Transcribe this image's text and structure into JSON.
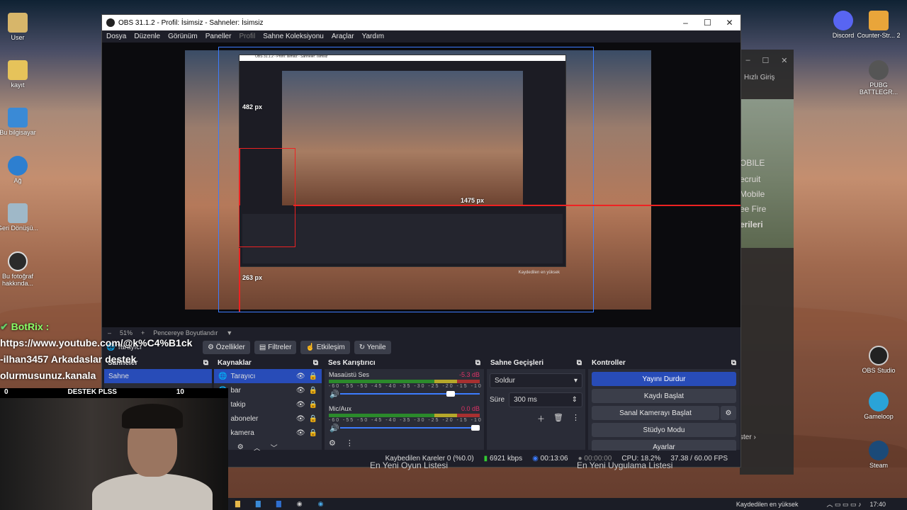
{
  "window": {
    "title": "OBS 31.1.2 - Profil: İsimsiz - Sahneler: İsimsiz",
    "controls": {
      "minimize": "–",
      "maximize": "☐",
      "close": "✕"
    }
  },
  "menu": [
    "Dosya",
    "Düzenle",
    "Görünüm",
    "Paneller",
    "Profil",
    "Sahne Koleksiyonu",
    "Araçlar",
    "Yardım"
  ],
  "preview": {
    "measurements": {
      "top": "482 px",
      "right": "1475 px",
      "bottom": "263 px"
    },
    "nested_title": "OBS 31.1.2 - Profil: İsimsiz - Sahneler: İsimsiz",
    "nested_status": "Kaydedilen en yüksek"
  },
  "zoom": {
    "minus": "–",
    "level": "51%",
    "plus": "+",
    "mode": "Pencereye Boyutlandır",
    "caret": "▼"
  },
  "context_bar": {
    "source_name": "Tarayıcı",
    "buttons": [
      "Özellikler",
      "Filtreler",
      "Etkileşim",
      "Yenile"
    ]
  },
  "docks": {
    "scenes": {
      "title": "Sahneler",
      "items": [
        "Sahne"
      ]
    },
    "sources": {
      "title": "Kaynaklar",
      "items": [
        {
          "name": "Tarayıcı",
          "selected": true
        },
        {
          "name": "bar",
          "selected": false
        },
        {
          "name": "takip",
          "selected": false
        },
        {
          "name": "aboneler",
          "selected": false
        },
        {
          "name": "kamera",
          "selected": false
        }
      ]
    },
    "mixer": {
      "title": "Ses Karıştırıcı",
      "channels": [
        {
          "name": "Masaüstü Ses",
          "db": "-5.3 dB",
          "volume": 0.82
        },
        {
          "name": "Mic/Aux",
          "db": "0.0 dB",
          "volume": 1.0
        }
      ],
      "ticks": "-60 -55 -50 -45 -40 -35 -30 -25 -20 -15 -10 -5 0"
    },
    "transitions": {
      "title": "Sahne Geçişleri",
      "type": "Soldur",
      "duration_label": "Süre",
      "duration": "300 ms"
    },
    "controls": {
      "title": "Kontroller",
      "buttons": [
        "Yayını Durdur",
        "Kaydı Başlat",
        "Sanal Kamerayı Başlat",
        "Stüdyo Modu",
        "Ayarlar"
      ]
    }
  },
  "status": {
    "dropped": "Kaybedilen Kareler 0 (%0.0)",
    "bitrate": "6921 kbps",
    "stream_time": "00:13:06",
    "rec_time": "00:00:00",
    "cpu": "CPU: 18.2%",
    "fps": "37.38 / 60.00 FPS"
  },
  "overlay": {
    "chat_user": "BotRix :",
    "chat_lines": [
      "https://www.youtube.com/@k%C4%B1ck",
      "-ilhan3457 Arkadaslar destek",
      "olurmusunuz.kanala"
    ],
    "goal_left": "0",
    "goal_label": "DESTEK PLSS",
    "goal_right": "10"
  },
  "behind_window": {
    "quick_login": "Hızlı Giriş",
    "items": [
      "OBILE",
      "ecruit",
      "Mobile",
      "ee Fire",
      "erileri"
    ],
    "more": "ster ›"
  },
  "background_text": {
    "games": "En Yeni Oyun Listesi",
    "apps": "En Yeni Uygulama Listesi"
  },
  "desktop_icons_left": [
    "User",
    "kayıt",
    "Bu bilgisayar",
    "Ağ",
    "Geri Dönüşü...",
    "Bu fotoğraf hakkında..."
  ],
  "desktop_icons_right": [
    "Discord",
    "Counter-Str... 2",
    "PUBG BATTLEGR...",
    "OBS Studio",
    "Gameloop",
    "Steam"
  ],
  "taskbar": {
    "notification": "Kaydedilen en yüksek",
    "time": "17:40"
  },
  "colors": {
    "accent": "#284cb8",
    "obs_bg": "#1e1f29",
    "dock_bg": "#2a2c37",
    "red_guide": "#e22222"
  }
}
